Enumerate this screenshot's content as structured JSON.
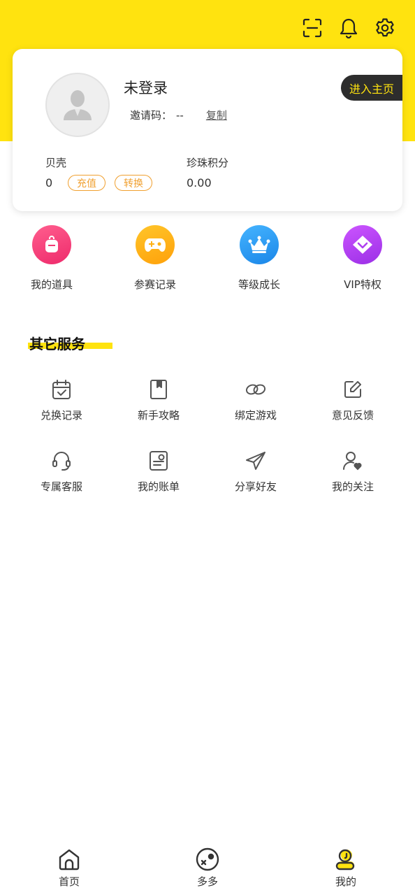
{
  "header": {
    "icons": [
      "scan-icon",
      "bell-icon",
      "settings-icon"
    ],
    "accent_color": "#ffe30f"
  },
  "profile": {
    "username": "未登录",
    "invite_label": "邀请码：",
    "invite_code": "--",
    "copy_label": "复制",
    "enter_home_label": "进入主页",
    "shells_label": "贝壳",
    "shells_value": "0",
    "recharge_label": "充值",
    "convert_label": "转换",
    "pearl_label": "珍珠积分",
    "pearl_value": "0.00"
  },
  "quick_actions": [
    {
      "label": "我的道具",
      "icon": "backpack-icon",
      "color": "#f5357a"
    },
    {
      "label": "参赛记录",
      "icon": "gamepad-icon",
      "color": "#ffad0d"
    },
    {
      "label": "等级成长",
      "icon": "crown-icon",
      "color": "#2d9bf0"
    },
    {
      "label": "VIP特权",
      "icon": "vip-diamond-icon",
      "color": "#b040f0"
    }
  ],
  "services": {
    "title": "其它服务",
    "items": [
      {
        "label": "兑换记录",
        "icon": "calendar-check-icon"
      },
      {
        "label": "新手攻略",
        "icon": "guide-book-icon"
      },
      {
        "label": "绑定游戏",
        "icon": "link-icon"
      },
      {
        "label": "意见反馈",
        "icon": "edit-note-icon"
      },
      {
        "label": "专属客服",
        "icon": "headset-icon"
      },
      {
        "label": "我的账单",
        "icon": "bill-icon"
      },
      {
        "label": "分享好友",
        "icon": "paper-plane-icon"
      },
      {
        "label": "我的关注",
        "icon": "user-heart-icon"
      }
    ]
  },
  "bottom_nav": {
    "items": [
      {
        "label": "首页",
        "icon": "home-icon"
      },
      {
        "label": "多多",
        "icon": "duoduo-icon"
      },
      {
        "label": "我的",
        "icon": "profile-icon",
        "active": true
      }
    ]
  }
}
